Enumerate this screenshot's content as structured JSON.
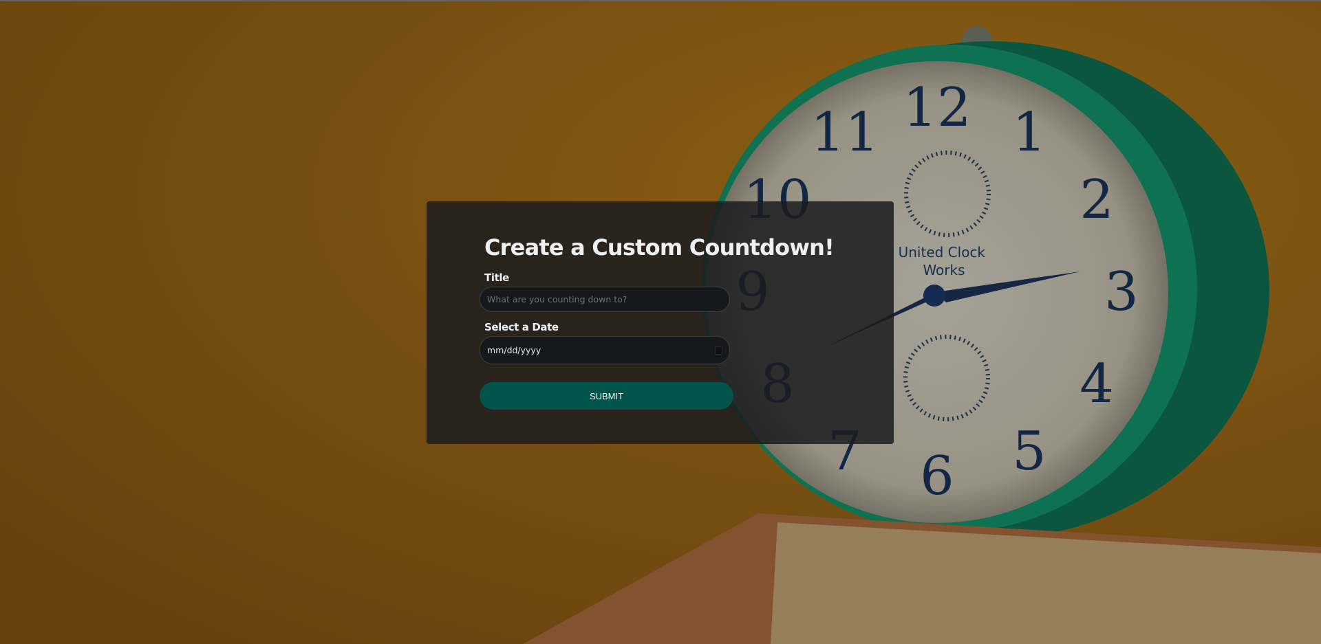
{
  "form": {
    "heading": "Create a Custom Countdown!",
    "title_label": "Title",
    "title_placeholder": "What are you counting down to?",
    "title_value": "",
    "date_label": "Select a Date",
    "date_placeholder": "mm/dd/yyyy",
    "submit_label": "SUBMIT"
  },
  "background": {
    "clock_brand_line1": "United Clock",
    "clock_brand_line2": "Works",
    "clock_numerals": [
      "12",
      "1",
      "2",
      "3",
      "4",
      "5",
      "6",
      "7",
      "8",
      "9",
      "10",
      "11"
    ]
  },
  "colors": {
    "accent": "#02554a",
    "panel": "#1c1c1e",
    "wall": "#8a5a14"
  }
}
